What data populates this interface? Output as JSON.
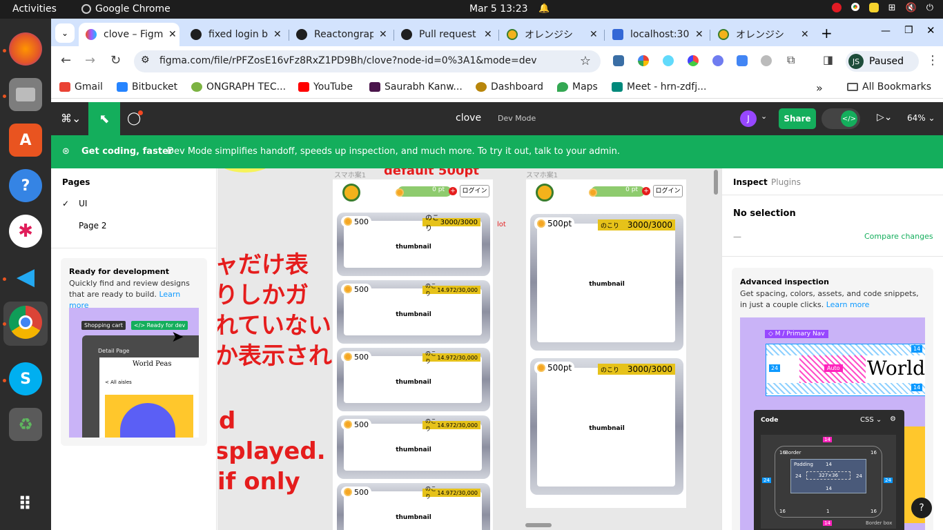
{
  "topbar": {
    "activities": "Activities",
    "app": "Google Chrome",
    "clock": "Mar 5  13:23"
  },
  "tabs": [
    {
      "title": "clove – Figma",
      "active": true
    },
    {
      "title": "fixed login b"
    },
    {
      "title": "Reactongrap"
    },
    {
      "title": "Pull request"
    },
    {
      "title": "オレンジシ"
    },
    {
      "title": "localhost:30"
    },
    {
      "title": "オレンジシ"
    }
  ],
  "omnibox": {
    "url": "figma.com/file/rPFZosE16vFz8RxZ1PD9Bh/clove?node-id=0%3A1&mode=dev"
  },
  "profile": {
    "initials": "JS",
    "status": "Paused"
  },
  "bookmarks": [
    {
      "label": "Gmail",
      "color": "#ea4335"
    },
    {
      "label": "Bitbucket",
      "color": "#2684ff"
    },
    {
      "label": "ONGRAPH TEC...",
      "color": "#7cb342"
    },
    {
      "label": "YouTube",
      "color": "#ff0000"
    },
    {
      "label": "Saurabh Kanw...",
      "color": "#4a154b"
    },
    {
      "label": "Dashboard",
      "color": "#b8860b"
    },
    {
      "label": "Maps",
      "color": "#34a853"
    },
    {
      "label": "Meet - hrn-zdfj...",
      "color": "#00897b"
    }
  ],
  "all_bookmarks": "All Bookmarks",
  "figma": {
    "file_name": "clove",
    "mode": "Dev Mode",
    "user_initial": "J",
    "share": "Share",
    "zoom": "64%",
    "banner_bold": "Get coding, faster",
    "banner_text": "Dev Mode simplifies handoff, speeds up inspection, and much more. To try it out, talk to your admin."
  },
  "pages": {
    "header": "Pages",
    "items": [
      "UI",
      "Page 2"
    ]
  },
  "ready": {
    "title": "Ready for development",
    "desc": "Quickly find and review designs that are ready to build.",
    "link": "Learn more",
    "chip1": "Shopping cart",
    "chip2": "</> Ready for dev",
    "detail": "Detail Page",
    "brand": "World Peas",
    "aisles": "< All aisles"
  },
  "canvas": {
    "frame1_label": "スマホ案1",
    "frame2_label": "スマホ案1",
    "top_note": "default 500pt",
    "lot": "lot",
    "jp_lines": [
      "ャだけ表",
      "りしかガ",
      "れていない",
      "か表示され"
    ],
    "en_lines": [
      "d",
      "splayed.",
      "if only"
    ],
    "points": "0 pt",
    "login": "ログイン",
    "price": "500",
    "price_pt": "500pt",
    "nokori": "のこり",
    "remain_full": "3000/3000",
    "remain_partial": "14.972/30,000",
    "thumbnail": "thumbnail"
  },
  "inspect": {
    "tab_inspect": "Inspect",
    "tab_plugins": "Plugins",
    "no_selection": "No selection",
    "dash": "—",
    "compare": "Compare changes",
    "adv_title": "Advanced inspection",
    "adv_desc": "Get spacing, colors, assets, and code snippets, in just a couple clicks.",
    "adv_link": "Learn more",
    "nav_label": "◇ M / Primary Nav",
    "world": "World",
    "auto": "Auto",
    "n24": "24",
    "n14": "14",
    "n16": "16",
    "code": "Code",
    "css": "CSS",
    "border": "Border",
    "padding": "Padding",
    "size": "327×36",
    "n1": "1",
    "border_box": "Border box",
    "help": "?"
  }
}
